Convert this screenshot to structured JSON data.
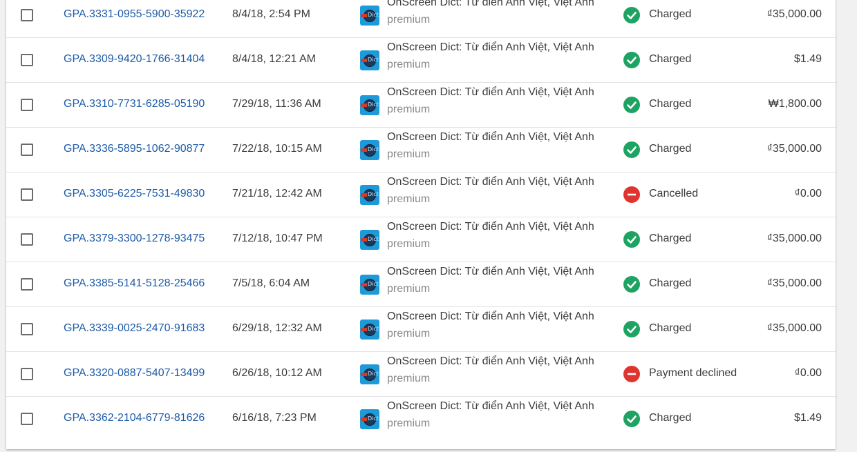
{
  "orders": [
    {
      "id": "GPA.3331-0955-5900-35922",
      "date": "8/4/18, 2:54 PM",
      "product": "OnScreen Dict: Từ điển Anh Việt, Việt Anh",
      "tier": "premium",
      "status": "Charged",
      "status_kind": "ok",
      "amount": "₫35,000.00"
    },
    {
      "id": "GPA.3309-9420-1766-31404",
      "date": "8/4/18, 12:21 AM",
      "product": "OnScreen Dict: Từ điển Anh Việt, Việt Anh",
      "tier": "premium",
      "status": "Charged",
      "status_kind": "ok",
      "amount": "$1.49"
    },
    {
      "id": "GPA.3310-7731-6285-05190",
      "date": "7/29/18, 11:36 AM",
      "product": "OnScreen Dict: Từ điển Anh Việt, Việt Anh",
      "tier": "premium",
      "status": "Charged",
      "status_kind": "ok",
      "amount": "₩1,800.00"
    },
    {
      "id": "GPA.3336-5895-1062-90877",
      "date": "7/22/18, 10:15 AM",
      "product": "OnScreen Dict: Từ điển Anh Việt, Việt Anh",
      "tier": "premium",
      "status": "Charged",
      "status_kind": "ok",
      "amount": "₫35,000.00"
    },
    {
      "id": "GPA.3305-6225-7531-49830",
      "date": "7/21/18, 12:42 AM",
      "product": "OnScreen Dict: Từ điển Anh Việt, Việt Anh",
      "tier": "premium",
      "status": "Cancelled",
      "status_kind": "bad",
      "amount": "₫0.00"
    },
    {
      "id": "GPA.3379-3300-1278-93475",
      "date": "7/12/18, 10:47 PM",
      "product": "OnScreen Dict: Từ điển Anh Việt, Việt Anh",
      "tier": "premium",
      "status": "Charged",
      "status_kind": "ok",
      "amount": "₫35,000.00"
    },
    {
      "id": "GPA.3385-5141-5128-25466",
      "date": "7/5/18, 6:04 AM",
      "product": "OnScreen Dict: Từ điển Anh Việt, Việt Anh",
      "tier": "premium",
      "status": "Charged",
      "status_kind": "ok",
      "amount": "₫35,000.00"
    },
    {
      "id": "GPA.3339-0025-2470-91683",
      "date": "6/29/18, 12:32 AM",
      "product": "OnScreen Dict: Từ điển Anh Việt, Việt Anh",
      "tier": "premium",
      "status": "Charged",
      "status_kind": "ok",
      "amount": "₫35,000.00"
    },
    {
      "id": "GPA.3320-0887-5407-13499",
      "date": "6/26/18, 10:12 AM",
      "product": "OnScreen Dict: Từ điển Anh Việt, Việt Anh",
      "tier": "premium",
      "status": "Payment declined",
      "status_kind": "bad",
      "amount": "₫0.00"
    },
    {
      "id": "GPA.3362-2104-6779-81626",
      "date": "6/16/18, 7:23 PM",
      "product": "OnScreen Dict: Từ điển Anh Việt, Việt Anh",
      "tier": "premium",
      "status": "Charged",
      "status_kind": "ok",
      "amount": "$1.49"
    }
  ],
  "app_icon": {
    "name": "dict-app-icon",
    "text": "Dict"
  },
  "colors": {
    "link": "#1d5ba8",
    "charged": "#1ea362",
    "declined": "#e0342f"
  }
}
